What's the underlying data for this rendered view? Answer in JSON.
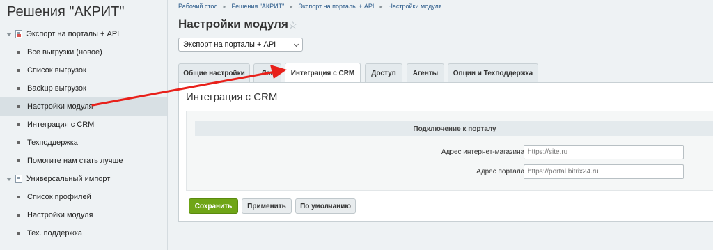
{
  "sidebar": {
    "title": "Решения \"АКРИТ\"",
    "groups": [
      {
        "label": "Экспорт на порталы + API",
        "items": [
          {
            "label": "Все выгрузки (новое)"
          },
          {
            "label": "Список выгрузок"
          },
          {
            "label": "Backup выгрузок"
          },
          {
            "label": "Настройки модуля"
          },
          {
            "label": "Интеграция с CRM"
          },
          {
            "label": "Техподдержка"
          },
          {
            "label": "Помогите нам стать лучше"
          }
        ]
      },
      {
        "label": "Универсальный импорт",
        "items": [
          {
            "label": "Список профилей"
          },
          {
            "label": "Настройки модуля"
          },
          {
            "label": "Тех. поддержка"
          }
        ]
      }
    ]
  },
  "breadcrumb": [
    "Рабочий стол",
    "Решения \"АКРИТ\"",
    "Экспорт на порталы + API",
    "Настройки модуля"
  ],
  "page": {
    "title": "Настройки модуля",
    "module_select": "Экспорт на порталы + API"
  },
  "tabs": [
    {
      "label": "Общие настройки"
    },
    {
      "label": "Лог"
    },
    {
      "label": "Интеграция с CRM"
    },
    {
      "label": "Доступ"
    },
    {
      "label": "Агенты"
    },
    {
      "label": "Опции и Техподдержка"
    }
  ],
  "panel": {
    "title": "Интеграция с CRM",
    "section_header": "Подключение к порталу",
    "fields": [
      {
        "label": "Адрес интернет-магазина:",
        "placeholder": "https://site.ru"
      },
      {
        "label": "Адрес портала:",
        "placeholder": "https://portal.bitrix24.ru"
      }
    ]
  },
  "buttons": {
    "save": "Сохранить",
    "apply": "Применить",
    "default": "По умолчанию"
  },
  "colors": {
    "accent_green": "#6fa517",
    "arrow_red": "#e8201a"
  }
}
